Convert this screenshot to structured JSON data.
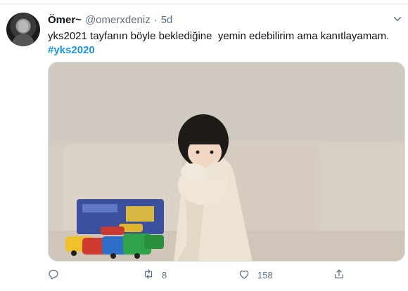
{
  "tweet": {
    "display_name": "Ömer~",
    "handle": "@omerxdeniz",
    "separator": "·",
    "time": "5d",
    "text": "yks2021 tayfanın böyle beklediğine  yemin edebilirim ama kanıtlayamam.",
    "hashtag": "#yks2020",
    "retweet_count": "8",
    "like_count": "158",
    "icons": {
      "more": "chevron-down-icon",
      "reply": "reply-icon",
      "retweet": "retweet-icon",
      "like": "heart-icon",
      "share": "share-icon"
    },
    "colors": {
      "link": "#1b95e0",
      "muted": "#5b7083",
      "text": "#0f1419"
    }
  }
}
